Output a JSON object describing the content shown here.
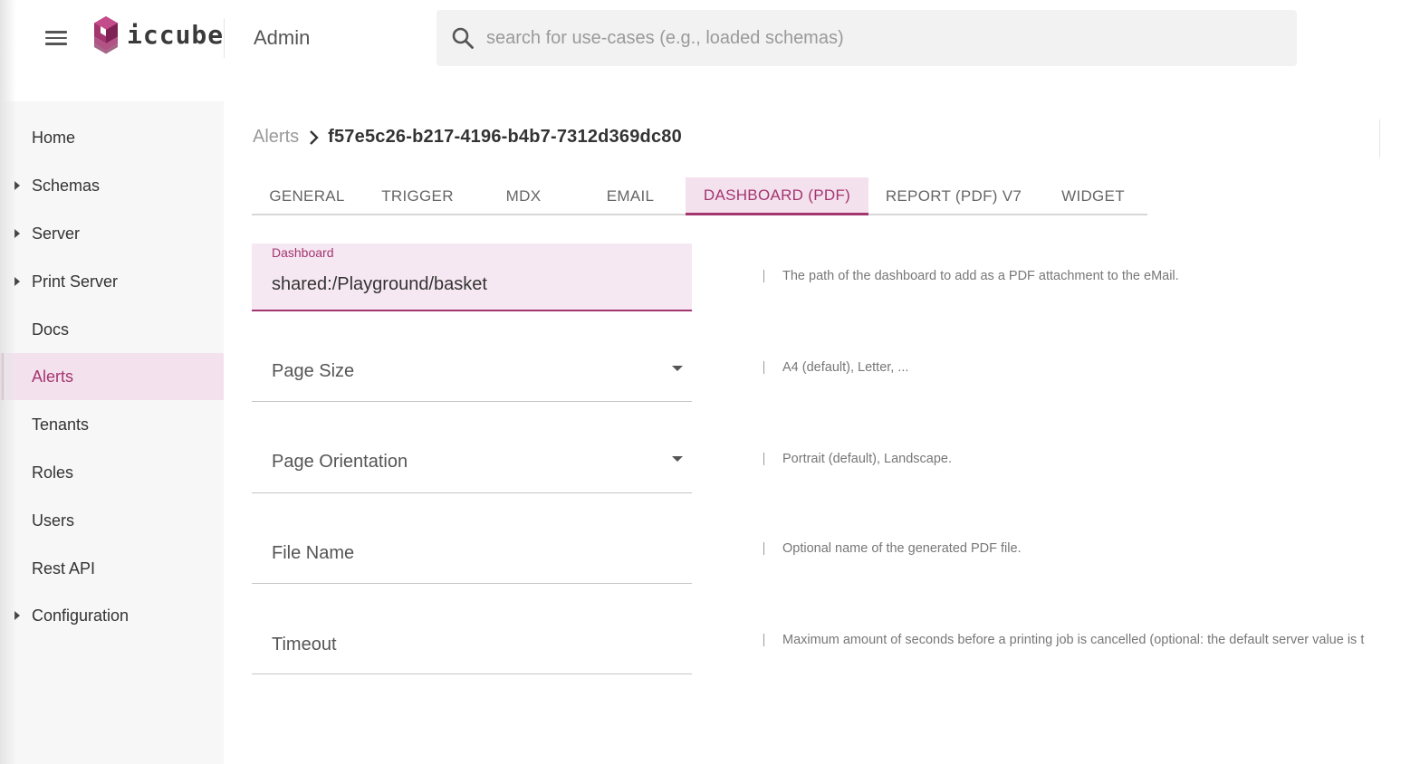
{
  "header": {
    "logo_text": "iccube",
    "app_title": "Admin",
    "search": {
      "placeholder": "search for use-cases (e.g., loaded schemas)",
      "value": ""
    }
  },
  "sidebar": {
    "items": [
      {
        "label": "Home",
        "expandable": false
      },
      {
        "label": "Schemas",
        "expandable": true
      },
      {
        "label": "Server",
        "expandable": true
      },
      {
        "label": "Print Server",
        "expandable": true
      },
      {
        "label": "Docs",
        "expandable": false
      },
      {
        "label": "Alerts",
        "expandable": false,
        "active": true
      },
      {
        "label": "Tenants",
        "expandable": false
      },
      {
        "label": "Roles",
        "expandable": false
      },
      {
        "label": "Users",
        "expandable": false
      },
      {
        "label": "Rest API",
        "expandable": false
      },
      {
        "label": "Configuration",
        "expandable": true
      }
    ]
  },
  "breadcrumb": {
    "parent": "Alerts",
    "current": "f57e5c26-b217-4196-b4b7-7312d369dc80"
  },
  "tabs": {
    "active": "DASHBOARD (PDF)",
    "items": [
      "GENERAL",
      "TRIGGER",
      "MDX",
      "EMAIL",
      "DASHBOARD (PDF)",
      "REPORT (PDF) V7",
      "WIDGET"
    ]
  },
  "form": {
    "dashboard": {
      "label": "Dashboard",
      "value": "shared:/Playground/basket",
      "help": "The path of the dashboard to add as a PDF attachment to the eMail."
    },
    "page_size": {
      "label": "Page Size",
      "help": "A4 (default), Letter, ..."
    },
    "page_orientation": {
      "label": "Page Orientation",
      "help": "Portrait (default), Landscape."
    },
    "file_name": {
      "label": "File Name",
      "help": "Optional name of the generated PDF file."
    },
    "timeout": {
      "label": "Timeout",
      "help": "Maximum amount of seconds before a printing job is cancelled (optional: the default server value is t"
    }
  },
  "colors": {
    "accent": "#a3356f",
    "accent_bg": "#f4e1ee",
    "sidebar_bg": "#f7f7f7",
    "search_bg": "#f2f2f2"
  }
}
